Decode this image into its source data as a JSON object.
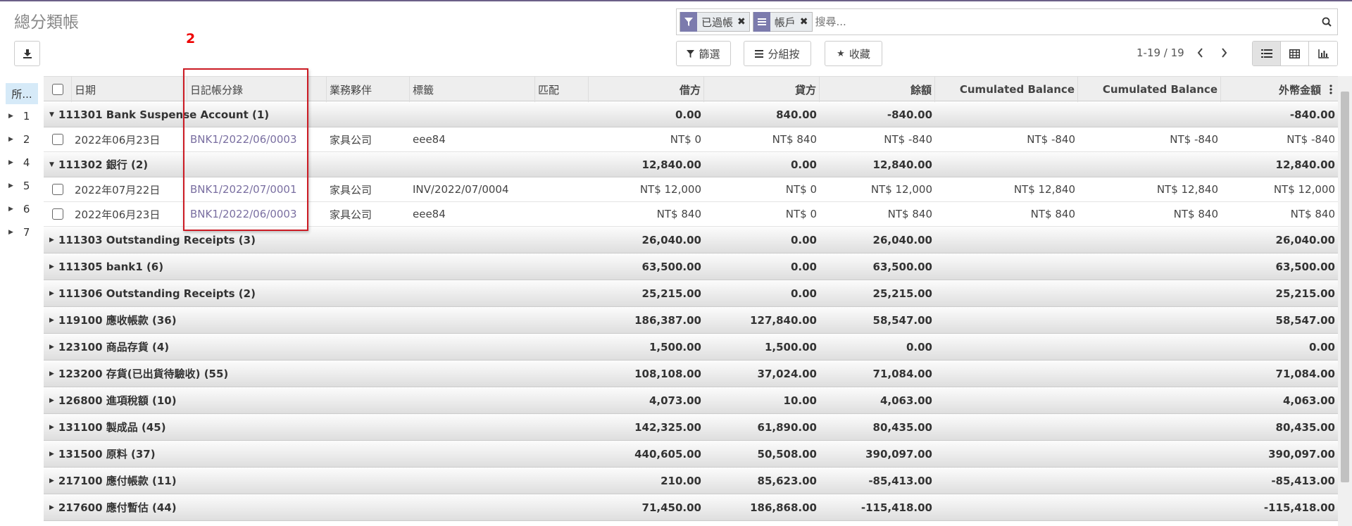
{
  "title": "總分類帳",
  "annotation": "2",
  "search": {
    "facets": [
      {
        "label": "已過帳",
        "icon": "filter-icon"
      },
      {
        "label": "帳戶",
        "icon": "group-icon"
      }
    ],
    "placeholder": "搜尋..."
  },
  "buttons": {
    "filter": "篩選",
    "groupby": "分組按",
    "favorites": "收藏"
  },
  "pager": "1-19 / 19",
  "side": {
    "all": "所...",
    "items": [
      "1",
      "2",
      "4",
      "5",
      "6",
      "7"
    ]
  },
  "columns": {
    "date": "日期",
    "entry": "日記帳分錄",
    "partner": "業務夥伴",
    "label": "標籤",
    "matching": "匹配",
    "debit": "借方",
    "credit": "貸方",
    "balance": "餘額",
    "cumulated1": "Cumulated Balance",
    "cumulated2": "Cumulated Balance",
    "currency": "外幣金額"
  },
  "rows": [
    {
      "kind": "group",
      "open": true,
      "name": "111301 Bank Suspense Account (1)",
      "debit": "0.00",
      "credit": "840.00",
      "balance": "-840.00",
      "currency": "-840.00"
    },
    {
      "kind": "record",
      "date": "2022年06月23日",
      "entry": "BNK1/2022/06/0003",
      "partner": "家具公司",
      "label": "eee84",
      "debit": "NT$ 0",
      "credit": "NT$ 840",
      "balance": "NT$ -840",
      "cum1": "NT$ -840",
      "cum2": "NT$ -840",
      "currency": "NT$ -840"
    },
    {
      "kind": "group",
      "open": true,
      "name": "111302 銀行 (2)",
      "debit": "12,840.00",
      "credit": "0.00",
      "balance": "12,840.00",
      "currency": "12,840.00"
    },
    {
      "kind": "record",
      "date": "2022年07月22日",
      "entry": "BNK1/2022/07/0001",
      "partner": "家具公司",
      "label": "INV/2022/07/0004",
      "debit": "NT$ 12,000",
      "credit": "NT$ 0",
      "balance": "NT$ 12,000",
      "cum1": "NT$ 12,840",
      "cum2": "NT$ 12,840",
      "currency": "NT$ 12,000"
    },
    {
      "kind": "record",
      "date": "2022年06月23日",
      "entry": "BNK1/2022/06/0003",
      "partner": "家具公司",
      "label": "eee84",
      "debit": "NT$ 840",
      "credit": "NT$ 0",
      "balance": "NT$ 840",
      "cum1": "NT$ 840",
      "cum2": "NT$ 840",
      "currency": "NT$ 840"
    },
    {
      "kind": "group",
      "open": false,
      "name": "111303 Outstanding Receipts (3)",
      "debit": "26,040.00",
      "credit": "0.00",
      "balance": "26,040.00",
      "currency": "26,040.00"
    },
    {
      "kind": "group",
      "open": false,
      "name": "111305 bank1 (6)",
      "debit": "63,500.00",
      "credit": "0.00",
      "balance": "63,500.00",
      "currency": "63,500.00"
    },
    {
      "kind": "group",
      "open": false,
      "name": "111306 Outstanding Receipts (2)",
      "debit": "25,215.00",
      "credit": "0.00",
      "balance": "25,215.00",
      "currency": "25,215.00"
    },
    {
      "kind": "group",
      "open": false,
      "name": "119100 應收帳款 (36)",
      "debit": "186,387.00",
      "credit": "127,840.00",
      "balance": "58,547.00",
      "currency": "58,547.00"
    },
    {
      "kind": "group",
      "open": false,
      "name": "123100 商品存貨 (4)",
      "debit": "1,500.00",
      "credit": "1,500.00",
      "balance": "0.00",
      "currency": "0.00"
    },
    {
      "kind": "group",
      "open": false,
      "name": "123200 存貨(已出貨待驗收) (55)",
      "debit": "108,108.00",
      "credit": "37,024.00",
      "balance": "71,084.00",
      "currency": "71,084.00"
    },
    {
      "kind": "group",
      "open": false,
      "name": "126800 進項稅額 (10)",
      "debit": "4,073.00",
      "credit": "10.00",
      "balance": "4,063.00",
      "currency": "4,063.00"
    },
    {
      "kind": "group",
      "open": false,
      "name": "131100 製成品 (45)",
      "debit": "142,325.00",
      "credit": "61,890.00",
      "balance": "80,435.00",
      "currency": "80,435.00"
    },
    {
      "kind": "group",
      "open": false,
      "name": "131500 原料 (37)",
      "debit": "440,605.00",
      "credit": "50,508.00",
      "balance": "390,097.00",
      "currency": "390,097.00"
    },
    {
      "kind": "group",
      "open": false,
      "name": "217100 應付帳款 (11)",
      "debit": "210.00",
      "credit": "85,623.00",
      "balance": "-85,413.00",
      "currency": "-85,413.00"
    },
    {
      "kind": "group",
      "open": false,
      "name": "217600 應付暫估 (44)",
      "debit": "71,450.00",
      "credit": "186,868.00",
      "balance": "-115,418.00",
      "currency": "-115,418.00"
    }
  ]
}
